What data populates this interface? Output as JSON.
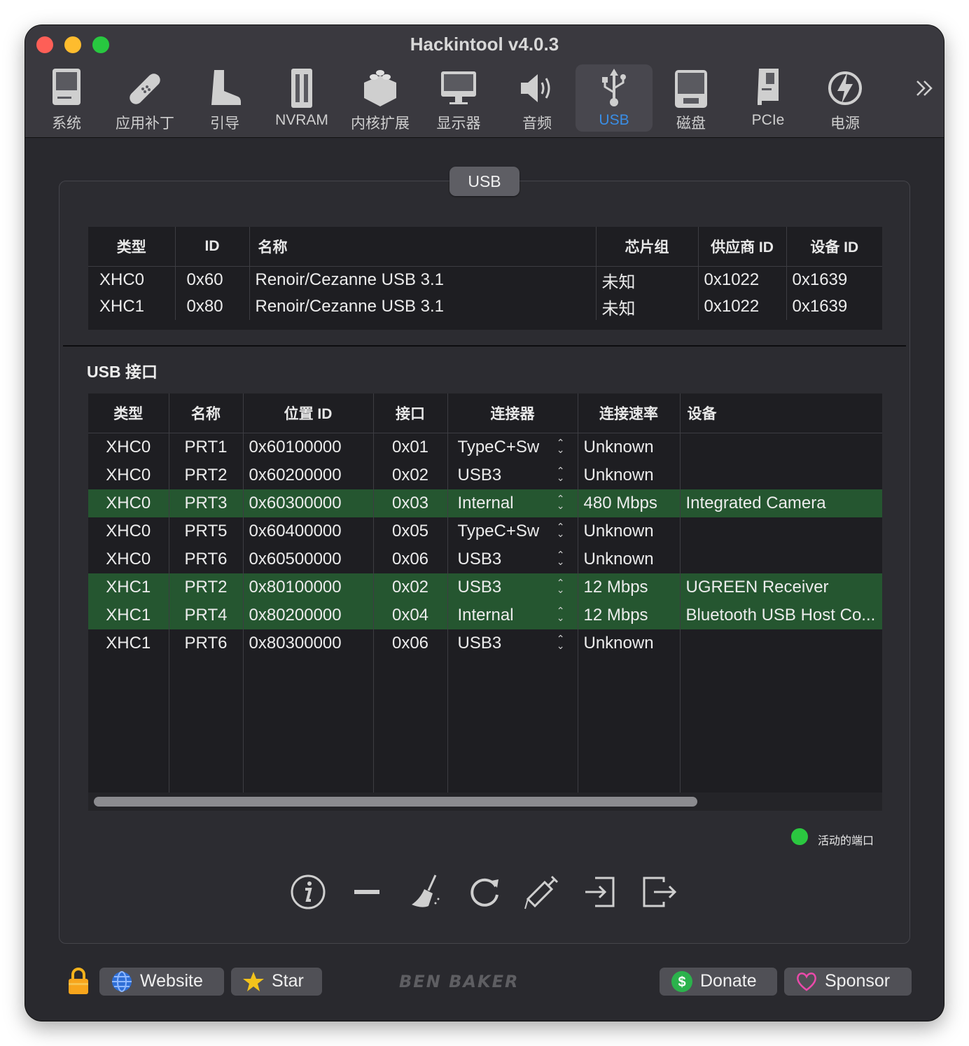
{
  "window": {
    "title": "Hackintool v4.0.3"
  },
  "toolbar": {
    "items": [
      {
        "label": "系统",
        "icon": "computer-icon"
      },
      {
        "label": "应用补丁",
        "icon": "bandage-icon"
      },
      {
        "label": "引导",
        "icon": "boot-icon"
      },
      {
        "label": "NVRAM",
        "icon": "memory-chip-icon"
      },
      {
        "label": "内核扩展",
        "icon": "lego-brick-icon"
      },
      {
        "label": "显示器",
        "icon": "monitor-icon"
      },
      {
        "label": "音频",
        "icon": "speaker-icon"
      },
      {
        "label": "USB",
        "icon": "usb-icon"
      },
      {
        "label": "磁盘",
        "icon": "disk-icon"
      },
      {
        "label": "PCIe",
        "icon": "pcie-card-icon"
      },
      {
        "label": "电源",
        "icon": "power-bolt-icon"
      }
    ],
    "active": "USB",
    "overflow_icon": "chevron-double-right-icon"
  },
  "segment": {
    "label": "USB"
  },
  "controllers": {
    "headers": [
      "类型",
      "ID",
      "名称",
      "芯片组",
      "供应商 ID",
      "设备 ID"
    ],
    "rows": [
      [
        "XHC0",
        "0x60",
        "Renoir/Cezanne USB 3.1",
        "未知",
        "0x1022",
        "0x1639"
      ],
      [
        "XHC1",
        "0x80",
        "Renoir/Cezanne USB 3.1",
        "未知",
        "0x1022",
        "0x1639"
      ]
    ]
  },
  "ports": {
    "title": "USB 接口",
    "headers": [
      "类型",
      "名称",
      "位置 ID",
      "接口",
      "连接器",
      "连接速率",
      "设备"
    ],
    "rows": [
      [
        "XHC0",
        "PRT1",
        "0x60100000",
        "0x01",
        "TypeC+Sw",
        "Unknown",
        ""
      ],
      [
        "XHC0",
        "PRT2",
        "0x60200000",
        "0x02",
        "USB3",
        "Unknown",
        ""
      ],
      [
        "XHC0",
        "PRT3",
        "0x60300000",
        "0x03",
        "Internal",
        "480 Mbps",
        "Integrated Camera"
      ],
      [
        "XHC0",
        "PRT5",
        "0x60400000",
        "0x05",
        "TypeC+Sw",
        "Unknown",
        ""
      ],
      [
        "XHC0",
        "PRT6",
        "0x60500000",
        "0x06",
        "USB3",
        "Unknown",
        ""
      ],
      [
        "XHC1",
        "PRT2",
        "0x80100000",
        "0x02",
        "USB3",
        "12 Mbps",
        "UGREEN Receiver"
      ],
      [
        "XHC1",
        "PRT4",
        "0x80200000",
        "0x04",
        "Internal",
        "12 Mbps",
        "Bluetooth USB Host Co..."
      ],
      [
        "XHC1",
        "PRT6",
        "0x80300000",
        "0x06",
        "USB3",
        "Unknown",
        ""
      ]
    ],
    "active_rows": [
      2,
      5,
      6
    ],
    "active_color": "#255630"
  },
  "legend": {
    "label": "活动的端口",
    "color": "#2bc840"
  },
  "actions": [
    "info-icon",
    "remove-icon",
    "broom-icon",
    "refresh-icon",
    "syringe-icon",
    "import-icon",
    "export-icon"
  ],
  "footer": {
    "website": "Website",
    "star": "Star",
    "logo": "BEN BAKER",
    "donate": "Donate",
    "sponsor": "Sponsor"
  }
}
